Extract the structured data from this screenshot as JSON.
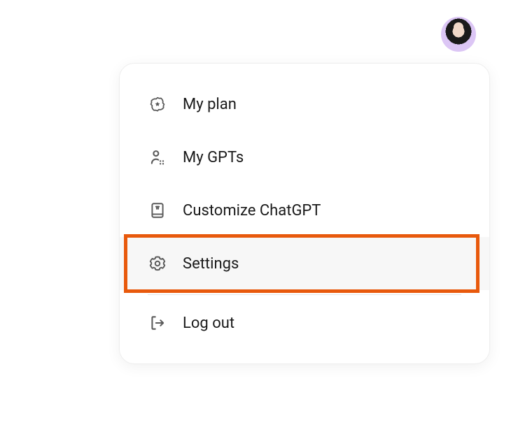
{
  "menu": {
    "items": [
      {
        "label": "My plan"
      },
      {
        "label": "My GPTs"
      },
      {
        "label": "Customize ChatGPT"
      },
      {
        "label": "Settings"
      },
      {
        "label": "Log out"
      }
    ]
  },
  "highlight_color": "#e8590c"
}
